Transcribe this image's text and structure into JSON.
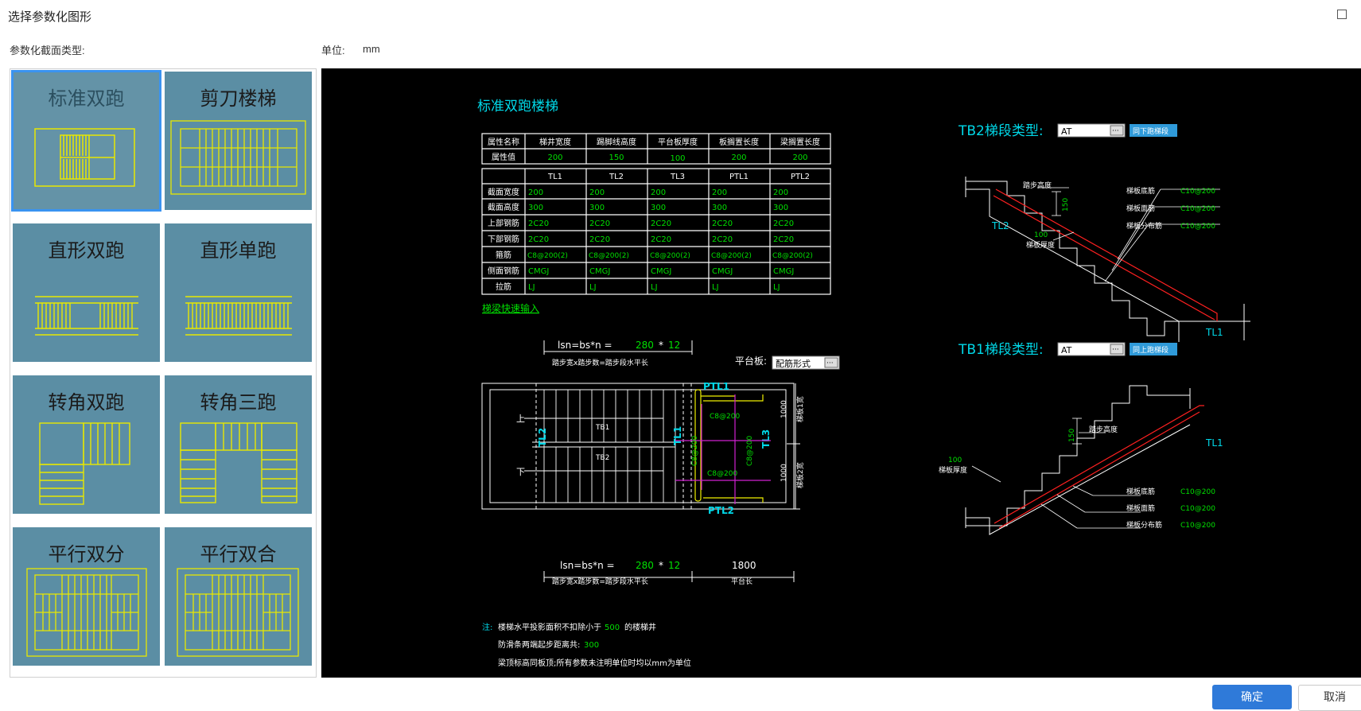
{
  "window": {
    "title": "选择参数化图形"
  },
  "labels": {
    "section_type": "参数化截面类型:",
    "unit_label": "单位:",
    "unit_value": "mm"
  },
  "gallery": [
    {
      "label": "标准双跑",
      "selected": true
    },
    {
      "label": "剪刀楼梯"
    },
    {
      "label": "直形双跑"
    },
    {
      "label": "直形单跑"
    },
    {
      "label": "转角双跑"
    },
    {
      "label": "转角三跑"
    },
    {
      "label": "平行双分"
    },
    {
      "label": "平行双合"
    }
  ],
  "preview": {
    "title": "标准双跑楼梯",
    "attr_table": {
      "headers": [
        "属性名称",
        "梯井宽度",
        "踢脚线高度",
        "平台板厚度",
        "板搁置长度",
        "梁搁置长度"
      ],
      "row_label": "属性值",
      "values": [
        "200",
        "150",
        "100",
        "200",
        "200"
      ]
    },
    "beam_table": {
      "columns": [
        "TL1",
        "TL2",
        "TL3",
        "PTL1",
        "PTL2"
      ],
      "rows": [
        {
          "label": "截面宽度",
          "values": [
            "200",
            "200",
            "200",
            "200",
            "200"
          ]
        },
        {
          "label": "截面高度",
          "values": [
            "300",
            "300",
            "300",
            "300",
            "300"
          ]
        },
        {
          "label": "上部钢筋",
          "values": [
            "2C20",
            "2C20",
            "2C20",
            "2C20",
            "2C20"
          ]
        },
        {
          "label": "下部钢筋",
          "values": [
            "2C20",
            "2C20",
            "2C20",
            "2C20",
            "2C20"
          ]
        },
        {
          "label": "箍筋",
          "values": [
            "C8@200(2)",
            "C8@200(2)",
            "C8@200(2)",
            "C8@200(2)",
            "C8@200(2)"
          ]
        },
        {
          "label": "侧面钢筋",
          "values": [
            "CMGJ",
            "CMGJ",
            "CMGJ",
            "CMGJ",
            "CMGJ"
          ]
        },
        {
          "label": "拉筋",
          "values": [
            "LJ",
            "LJ",
            "LJ",
            "LJ",
            "LJ"
          ]
        }
      ]
    },
    "quick_input_link": "梯梁快速输入",
    "plan": {
      "top_formula_prefix": "lsn=bs*n =",
      "top_value": "280",
      "top_star": "*",
      "top_count": "12",
      "top_caption": "踏步宽x踏步数=踏步段水平长",
      "platform_label": "平台板:",
      "platform_value": "配筋形式",
      "bottom_formula_prefix": "lsn=bs*n =",
      "bottom_value": "280",
      "bottom_star": "*",
      "bottom_count": "12",
      "bottom_caption": "踏步宽x踏步数=踏步段水平长",
      "platform_length": "1800",
      "platform_length_caption": "平台长",
      "up": "上",
      "down": "下",
      "tb1": "TB1",
      "tb2": "TB2",
      "tl1": "TL1",
      "tl2": "TL2",
      "tl3": "TL3",
      "ptl1": "PTL1",
      "ptl2": "PTL2",
      "rebar_top": "C8@200",
      "rebar_bottom": "C8@200",
      "rebar_left": "C8@200",
      "rebar_right": "C8@200",
      "dim1": "1000",
      "dim2": "1000",
      "dim1_caption": "梯板1宽",
      "dim2_caption": "梯板2宽"
    },
    "notes": {
      "prefix": "注:",
      "line1_a": "楼梯水平投影面积不扣除小于",
      "line1_value": "500",
      "line1_b": "的楼梯井",
      "line2_a": "防滑条两端起步距离共:",
      "line2_value": "300",
      "line3": "梁顶标高同板顶;所有参数未注明单位时均以mm为单位"
    },
    "tb2_section": {
      "label": "TB2梯段类型:",
      "type_value": "AT",
      "button": "同下跑梯段",
      "step_height": "踏步高度",
      "step_height_value": "150",
      "bottom_rebar": "梯板底筋",
      "bottom_rebar_value": "C10@200",
      "top_rebar": "梯板面筋",
      "top_rebar_value": "C10@200",
      "dist_rebar": "梯板分布筋",
      "dist_rebar_value": "C10@200",
      "thickness_value": "100",
      "thickness": "梯板厚度",
      "tl2": "TL2",
      "tl1": "TL1"
    },
    "tb1_section": {
      "label": "TB1梯段类型:",
      "type_value": "AT",
      "button": "同上跑梯段",
      "step_height": "踏步高度",
      "step_height_value": "150",
      "thickness_value": "100",
      "thickness": "梯板厚度",
      "bottom_rebar": "梯板底筋",
      "bottom_rebar_value": "C10@200",
      "top_rebar": "梯板面筋",
      "top_rebar_value": "C10@200",
      "dist_rebar": "梯板分布筋",
      "dist_rebar_value": "C10@200",
      "tl1": "TL1"
    }
  },
  "buttons": {
    "ok": "确定",
    "cancel": "取消"
  },
  "colors": {
    "accent": "#2f7ad9",
    "tile_bg": "#5b8ea4",
    "cad_yellow": "#f0f000",
    "cad_cyan": "#00d8e8",
    "cad_green": "#00e000",
    "cad_red": "#ff2020",
    "cad_magenta": "#d020d0"
  }
}
